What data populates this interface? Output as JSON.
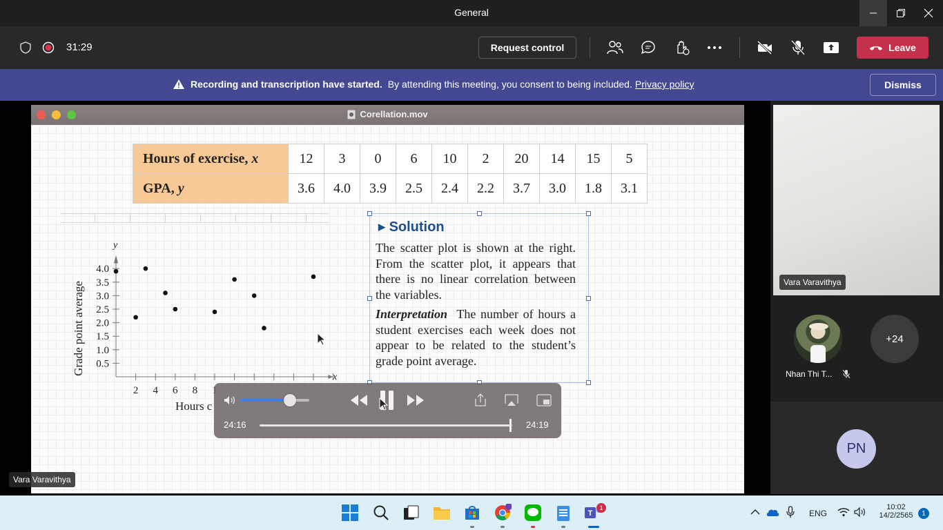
{
  "window": {
    "title": "General"
  },
  "meeting": {
    "timer": "31:29",
    "request_control_label": "Request control",
    "leave_label": "Leave"
  },
  "banner": {
    "bold_text": "Recording and transcription have started.",
    "text": "By attending this meeting, you consent to being included.",
    "link_text": "Privacy policy",
    "dismiss_label": "Dismiss"
  },
  "shared_window": {
    "filename": "Corellation.mov",
    "table": {
      "row1_label": "Hours of exercise, ",
      "row1_var": "x",
      "row2_label": "GPA, ",
      "row2_var": "y",
      "hours": [
        "12",
        "3",
        "0",
        "6",
        "10",
        "2",
        "20",
        "14",
        "15",
        "5"
      ],
      "gpa": [
        "3.6",
        "4.0",
        "3.9",
        "2.5",
        "2.4",
        "2.2",
        "3.7",
        "3.0",
        "1.8",
        "3.1"
      ]
    },
    "solution": {
      "title": "Solution",
      "paragraph1": "The scatter plot is shown at the right. From the scatter plot, it appears that there is no linear correlation between the variables.",
      "interpretation_label": "Interpretation",
      "interpretation_text": "The number of hours a student exercises each week does not appear to be related to the student’s grade point average."
    }
  },
  "chart_data": {
    "type": "scatter",
    "xlabel": "Hours c",
    "ylabel": "Grade point average",
    "x_axis_letter": "x",
    "y_axis_letter": "y",
    "xlim": [
      0,
      22
    ],
    "ylim": [
      0,
      4.3
    ],
    "xticks": [
      "2",
      "4",
      "6",
      "8",
      "1"
    ],
    "yticks": [
      "0.5",
      "1.0",
      "1.5",
      "2.0",
      "2.5",
      "3.0",
      "3.5",
      "4.0"
    ],
    "points": [
      {
        "x": 0,
        "y": 3.9
      },
      {
        "x": 2,
        "y": 2.2
      },
      {
        "x": 3,
        "y": 4.0
      },
      {
        "x": 5,
        "y": 3.1
      },
      {
        "x": 6,
        "y": 2.5
      },
      {
        "x": 10,
        "y": 2.4
      },
      {
        "x": 12,
        "y": 3.6
      },
      {
        "x": 14,
        "y": 3.0
      },
      {
        "x": 15,
        "y": 1.8
      },
      {
        "x": 20,
        "y": 3.7
      }
    ]
  },
  "video_controls": {
    "current_time": "24:16",
    "end_time": "24:19",
    "progress": 0.99,
    "volume": 0.72
  },
  "participants": {
    "main_tile_name": "Vara Varavithya",
    "second_name": "Nhan Thi T...",
    "overflow_count": "+24",
    "avatar_initials": "PN",
    "presenter_name": "Vara Varavithya"
  },
  "taskbar": {
    "language": "ENG",
    "time": "10:02",
    "date": "14/2/2565",
    "notification_count": "1",
    "teams_badge": "1"
  },
  "colors": {
    "leave": "#c4314b",
    "banner": "#444791",
    "table_header": "#f6c997",
    "solution_title": "#1c4e8a"
  }
}
